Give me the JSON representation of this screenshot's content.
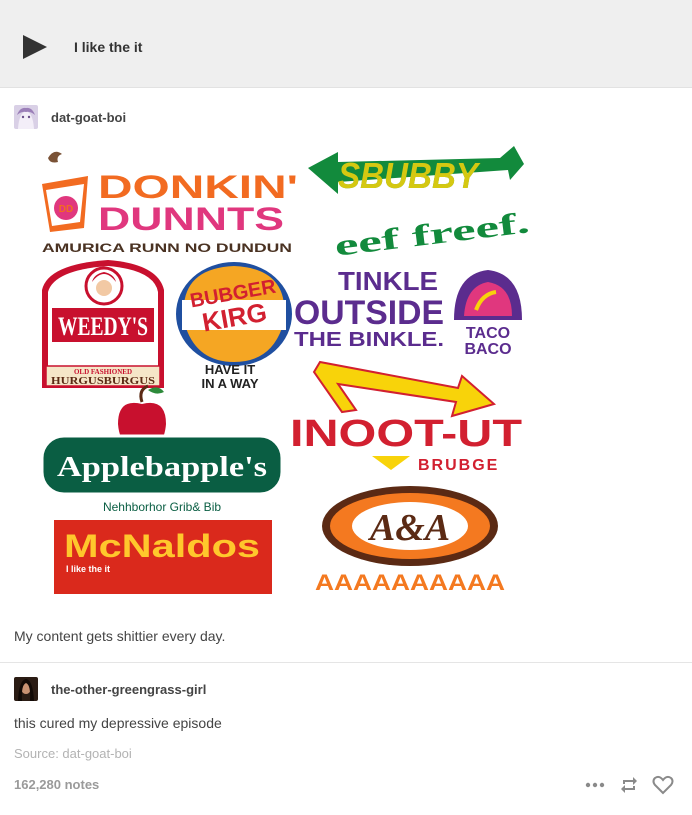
{
  "audio": {
    "track_title": "I like the it"
  },
  "post": {
    "username": "dat-goat-boi",
    "caption": "My content gets shittier every day."
  },
  "logos": {
    "donkin_line1": "DONKIN'",
    "donkin_line2": "DUNNTS",
    "donkin_badge": "DD",
    "donkin_tagline": "AMURICA RUNN NO DUNDUN",
    "sbubby": "SBUBBY",
    "sbubby_tagline": "eef freef.",
    "weedys": "WEEDY'S",
    "weedys_band1": "OLD FASHIONED",
    "weedys_band2": "HURGUSBURGUS",
    "bubger_line1": "BUBGER",
    "bubger_line2": "KIRG",
    "bubger_tagline1": "HAVE IT",
    "bubger_tagline2": "IN A WAY",
    "tinkle_line1": "TINKLE",
    "tinkle_line2": "OUTSIDE",
    "tinkle_line3": "THE BINKLE.",
    "tacobaco_line1": "TACO",
    "tacobaco_line2": "BACO",
    "inootut": "INOOT-UT",
    "inootut_sub": "BRUBGE",
    "applebapples": "Applebapple's",
    "applebapples_tagline": "Nehhborhor Grib& Bib",
    "mcnaldos": "McNaldos",
    "mcnaldos_tagline": "I like the it",
    "aa_logo": "A&A",
    "aa_tagline": "AAAAAAAAAA"
  },
  "reblog": {
    "username": "the-other-greengrass-girl",
    "text": "this cured my depressive episode",
    "source": "Source: dat-goat-boi"
  },
  "footer": {
    "notes": "162,280 notes"
  },
  "colors": {
    "dunkin_orange": "#f26b21",
    "dunkin_pink": "#e0377e",
    "subway_green": "#128a3c",
    "subway_yellow": "#f8d30a",
    "wendys_red": "#c8102e",
    "bk_red": "#d22030",
    "bk_blue": "#1f4fa0",
    "taco_purple": "#5b2c8e",
    "applebees_green": "#0a5e43",
    "mcd_red": "#da291c",
    "mcd_yellow": "#ffc72c",
    "aw_orange": "#f47920",
    "aw_brown": "#5b2a14"
  }
}
